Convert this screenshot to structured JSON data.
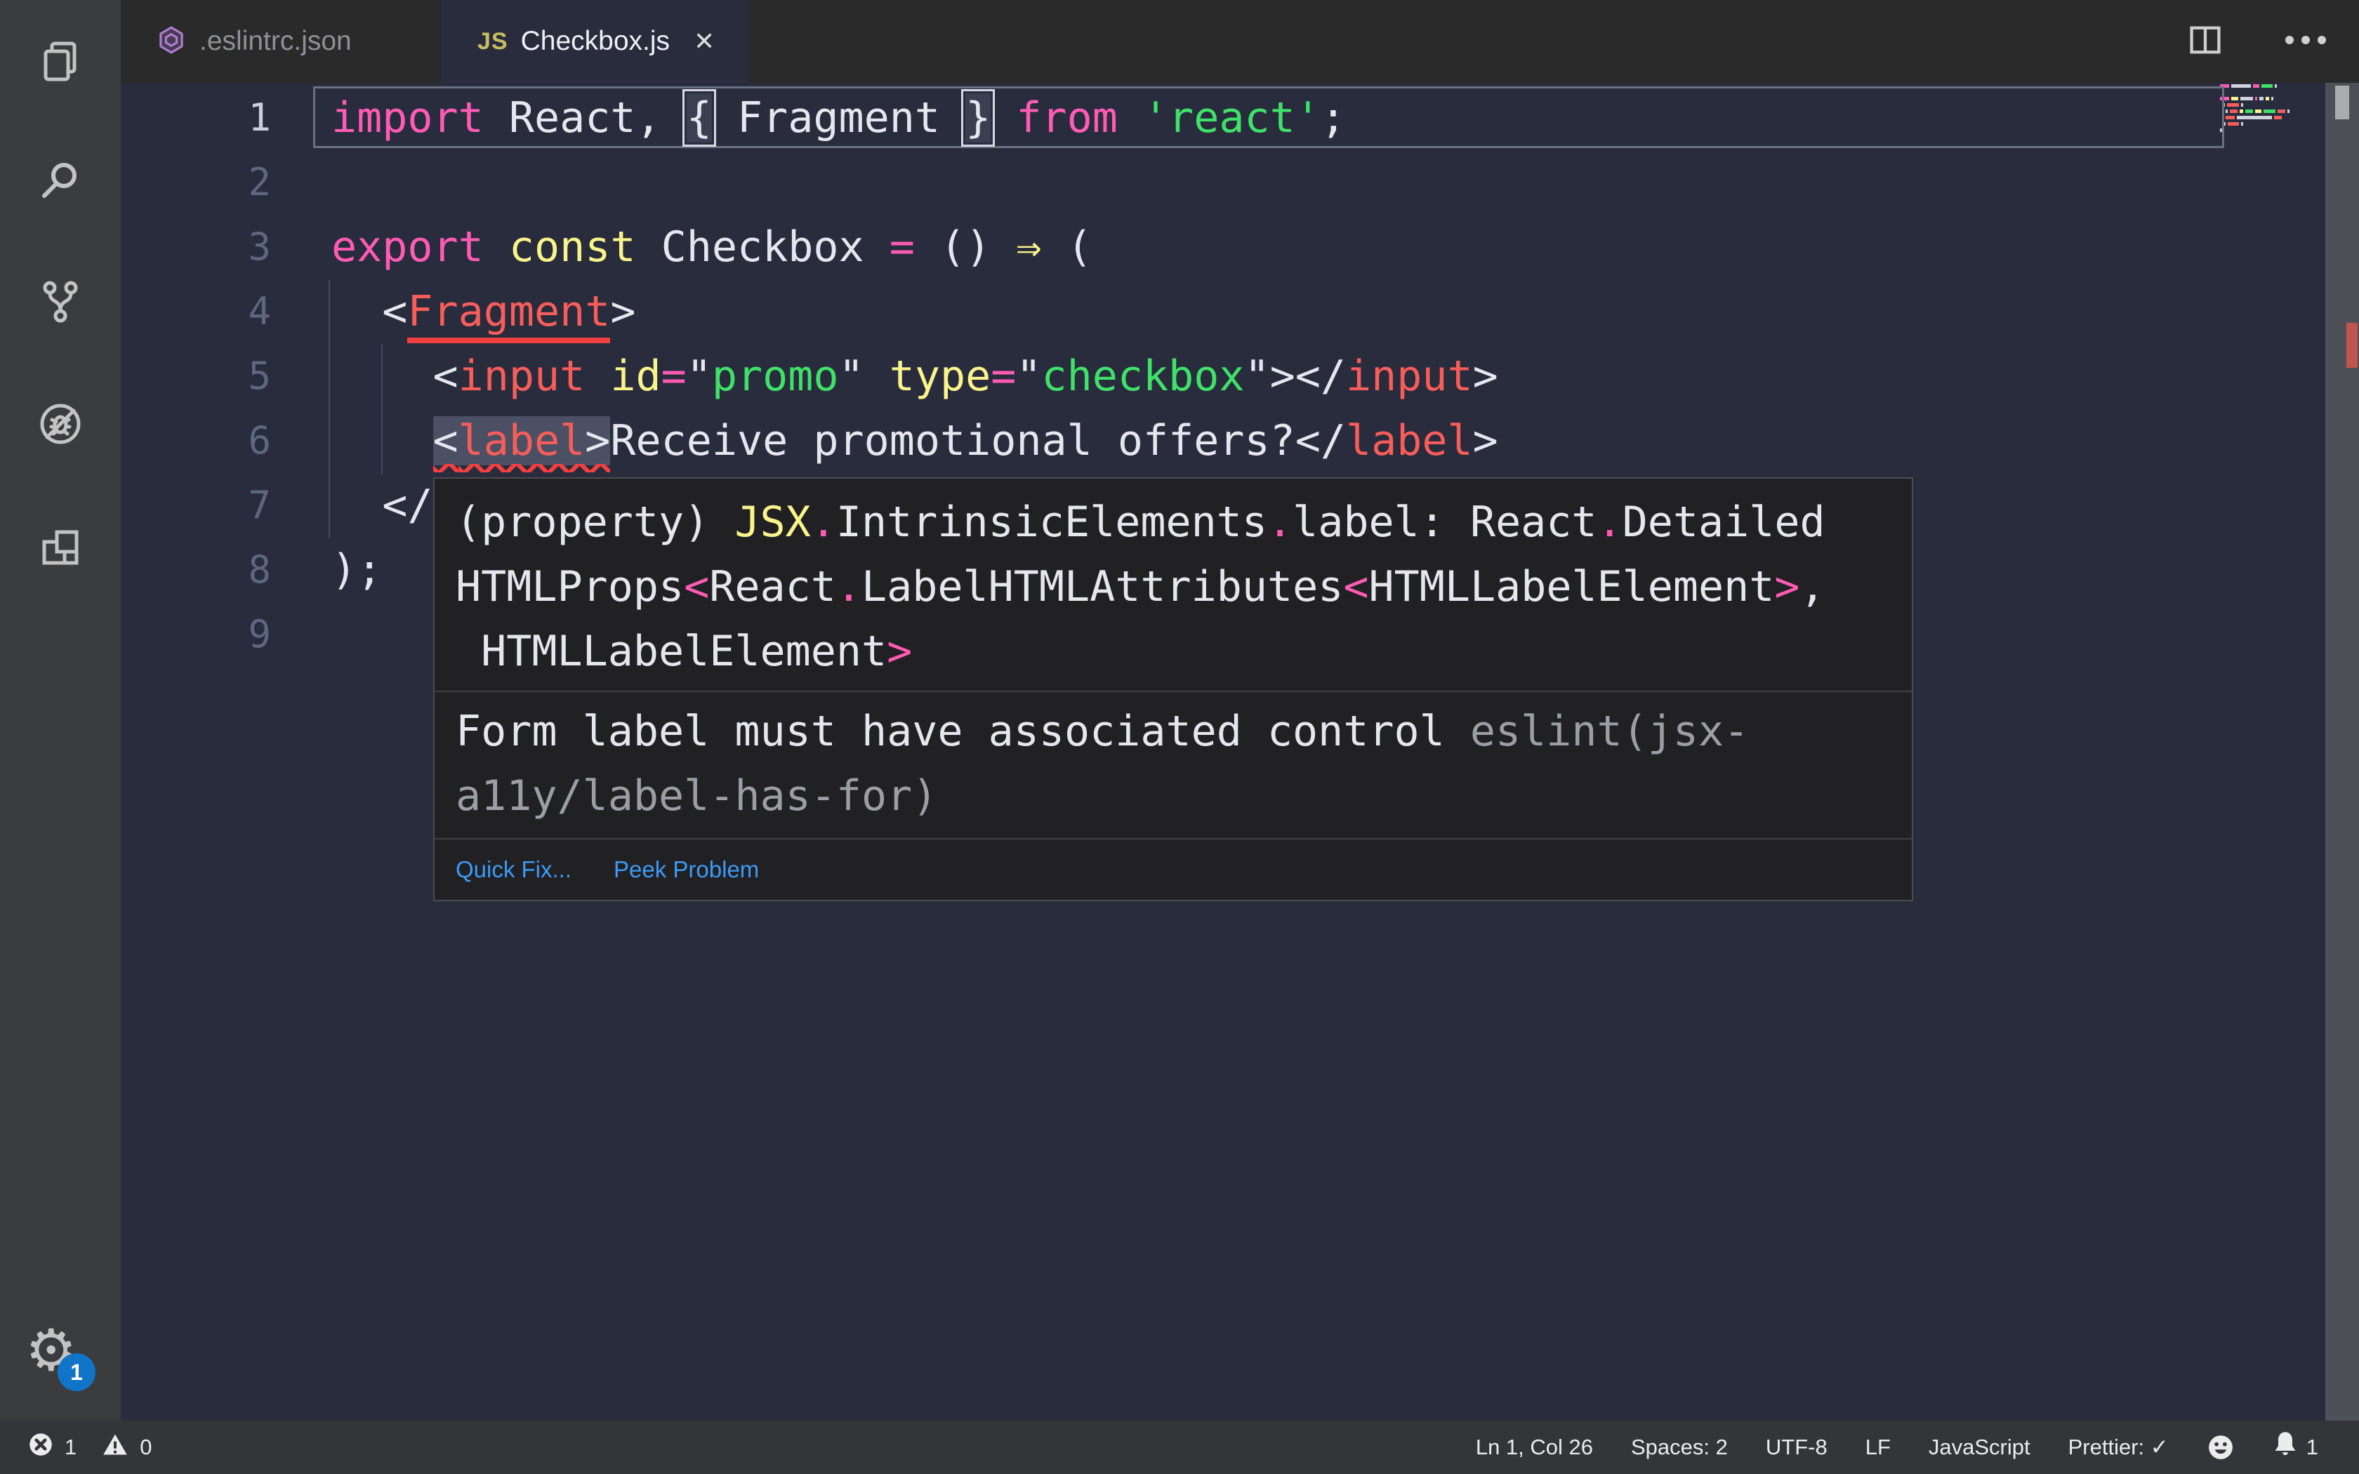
{
  "tabs": [
    {
      "label": ".eslintrc.json",
      "icon": "eslint-icon",
      "active": false
    },
    {
      "label": "Checkbox.js",
      "icon": "js-icon",
      "icon_text": "JS",
      "close": "✕",
      "active": true
    }
  ],
  "editor": {
    "lines": [
      {
        "num": "1",
        "current": true,
        "tokens": [
          [
            "kw",
            "import"
          ],
          [
            "fg",
            " React, "
          ],
          [
            "fgb",
            "{"
          ],
          [
            "fg",
            " Fragment "
          ],
          [
            "fgb",
            "}"
          ],
          [
            "fg",
            " "
          ],
          [
            "kw",
            "from"
          ],
          [
            "fg",
            " "
          ],
          [
            "str",
            "'react'"
          ],
          [
            "fg",
            ";"
          ]
        ]
      },
      {
        "num": "2",
        "tokens": []
      },
      {
        "num": "3",
        "tokens": [
          [
            "kw",
            "export"
          ],
          [
            "fg",
            " "
          ],
          [
            "yel",
            "const"
          ],
          [
            "fg",
            " Checkbox "
          ],
          [
            "op",
            "="
          ],
          [
            "fg",
            " () "
          ],
          [
            "yel",
            "⇒"
          ],
          [
            "fg",
            " ("
          ]
        ]
      },
      {
        "num": "4",
        "tokens": [
          [
            "fg",
            "  <"
          ],
          [
            "tagerr",
            "Fragment"
          ],
          [
            "fg",
            ">"
          ]
        ]
      },
      {
        "num": "5",
        "tokens": [
          [
            "fg",
            "    <"
          ],
          [
            "tag",
            "input"
          ],
          [
            "fg",
            " "
          ],
          [
            "yel",
            "id"
          ],
          [
            "op",
            "="
          ],
          [
            "fg",
            "\""
          ],
          [
            "str",
            "promo"
          ],
          [
            "fg",
            "\" "
          ],
          [
            "yel",
            "type"
          ],
          [
            "op",
            "="
          ],
          [
            "fg",
            "\""
          ],
          [
            "str",
            "checkbox"
          ],
          [
            "fg",
            "\""
          ],
          [
            "fg",
            "></"
          ],
          [
            "tag",
            "input"
          ],
          [
            "fg",
            ">"
          ]
        ]
      },
      {
        "num": "6",
        "tokens": [
          [
            "fg",
            "    "
          ],
          [
            "hlfg sqg",
            "<"
          ],
          [
            "hltag sqg",
            "label"
          ],
          [
            "hlfg sqg",
            ">"
          ],
          [
            "fg",
            "Receive promotional offers?"
          ],
          [
            "fg",
            "</"
          ],
          [
            "tag",
            "label"
          ],
          [
            "fg",
            ">"
          ]
        ]
      },
      {
        "num": "7",
        "tokens": [
          [
            "fg",
            "  </"
          ]
        ]
      },
      {
        "num": "8",
        "tokens": [
          [
            "fg",
            ");"
          ]
        ]
      },
      {
        "num": "9",
        "tokens": []
      }
    ]
  },
  "tooltip": {
    "type_lines": [
      [
        [
          "fg",
          "(property) "
        ],
        [
          "yel",
          "JSX"
        ],
        [
          "op",
          "."
        ],
        [
          "fg",
          "IntrinsicElements"
        ],
        [
          "op",
          "."
        ],
        [
          "fg",
          "label: React"
        ],
        [
          "op",
          "."
        ],
        [
          "fg",
          "Detailed"
        ]
      ],
      [
        [
          "fg",
          "HTMLProps"
        ],
        [
          "op",
          "<"
        ],
        [
          "fg",
          "React"
        ],
        [
          "op",
          "."
        ],
        [
          "fg",
          "LabelHTMLAttributes"
        ],
        [
          "op",
          "<"
        ],
        [
          "fg",
          "HTMLLabelElement"
        ],
        [
          "op",
          ">"
        ],
        [
          "fg",
          ","
        ]
      ],
      [
        [
          "fg",
          " HTMLLabelElement"
        ],
        [
          "op",
          ">"
        ]
      ]
    ],
    "message_lines": [
      [
        [
          "fg",
          "Form label must have associated control "
        ],
        [
          "gray",
          "eslint(jsx-"
        ]
      ],
      [
        [
          "gray",
          "a11y/label-has-for)"
        ]
      ]
    ],
    "actions": [
      {
        "label": "Quick Fix..."
      },
      {
        "label": "Peek Problem"
      }
    ]
  },
  "status_bar": {
    "left": [
      {
        "icon": "error-icon",
        "value": "1"
      },
      {
        "icon": "warning-icon",
        "value": "0"
      }
    ],
    "right": [
      "Ln 1, Col 26",
      "Spaces: 2",
      "UTF-8",
      "LF",
      "JavaScript",
      "Prettier: ✓"
    ],
    "bell_count": "1"
  },
  "activity_bar": {
    "items": [
      {
        "name": "explorer-icon"
      },
      {
        "name": "search-icon"
      },
      {
        "name": "source-control-icon"
      },
      {
        "name": "debug-icon"
      },
      {
        "name": "extensions-icon"
      }
    ],
    "settings_badge": "1"
  },
  "minimap": {
    "rows": [
      {
        "line": 1,
        "indent": 0,
        "segs": [
          [
            "kw",
            13
          ],
          [
            "fg",
            28
          ],
          [
            "kw",
            9
          ],
          [
            "str",
            16
          ],
          [
            "fg",
            3
          ]
        ]
      },
      {
        "line": 3,
        "indent": 0,
        "segs": [
          [
            "kw",
            13
          ],
          [
            "yel",
            10
          ],
          [
            "fg",
            18
          ],
          [
            "kw",
            3
          ],
          [
            "fg",
            6
          ],
          [
            "yel",
            5
          ],
          [
            "fg",
            3
          ]
        ]
      },
      {
        "line": 4,
        "indent": 4,
        "segs": [
          [
            "fg",
            3
          ],
          [
            "tag",
            17
          ],
          [
            "fg",
            3
          ]
        ]
      },
      {
        "line": 5,
        "indent": 8,
        "segs": [
          [
            "fg",
            3
          ],
          [
            "tag",
            11
          ],
          [
            "yel",
            5
          ],
          [
            "str",
            11
          ],
          [
            "yel",
            9
          ],
          [
            "str",
            17
          ],
          [
            "tag",
            11
          ],
          [
            "fg",
            3
          ]
        ]
      },
      {
        "line": 6,
        "indent": 8,
        "segs": [
          [
            "tag",
            13
          ],
          [
            "fg",
            50
          ],
          [
            "tag",
            11
          ]
        ]
      },
      {
        "line": 7,
        "indent": 4,
        "segs": [
          [
            "fg",
            4
          ],
          [
            "tag",
            16
          ],
          [
            "fg",
            3
          ]
        ]
      },
      {
        "line": 8,
        "indent": 0,
        "segs": [
          [
            "fg",
            5
          ]
        ]
      }
    ]
  },
  "colors": {
    "accent_blue": "#1074c9",
    "link_blue": "#3c9bf5",
    "error_red": "#f23f3f",
    "keyword_pink": "#ff5bb5",
    "string_green": "#3fe268",
    "tag_red": "#f95d5a",
    "attr_yellow": "#faf48b",
    "code_fg": "#e6e6ee",
    "editor_bg": "#282c3d",
    "panel_bg": "#2a2a2b",
    "activitybar_bg": "#3b3c3e",
    "statusbar_bg": "#333539",
    "tooltip_bg": "#212124"
  }
}
